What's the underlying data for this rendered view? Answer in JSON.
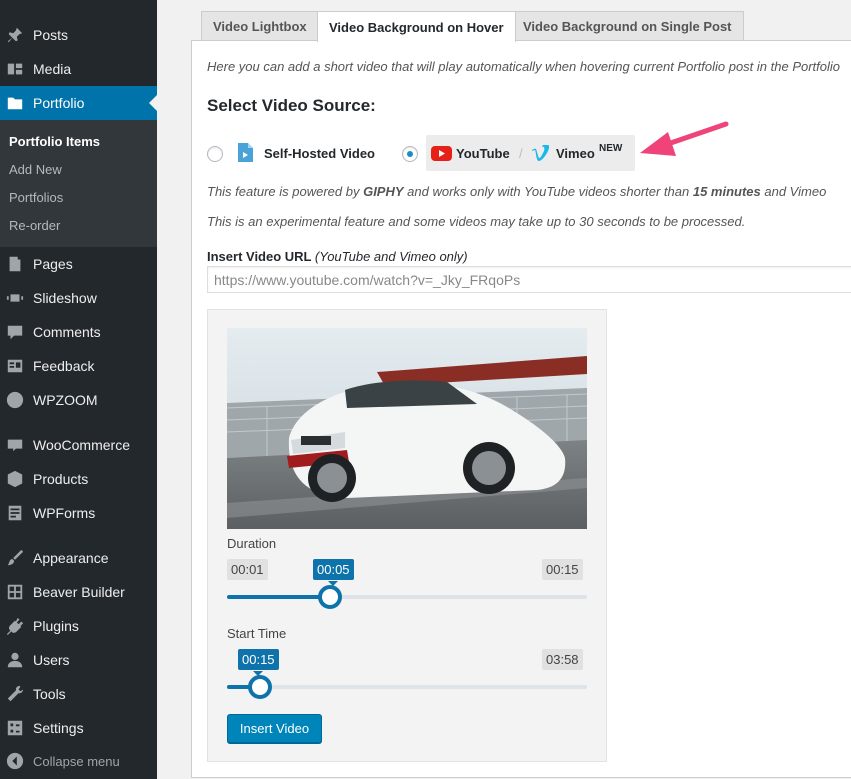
{
  "sidebar": {
    "items": [
      {
        "label": "Posts",
        "icon": "pin-icon"
      },
      {
        "label": "Media",
        "icon": "media-icon"
      },
      {
        "label": "Portfolio",
        "icon": "folder-icon"
      },
      {
        "label": "Pages",
        "icon": "pages-icon"
      },
      {
        "label": "Slideshow",
        "icon": "slideshow-icon"
      },
      {
        "label": "Comments",
        "icon": "comments-icon"
      },
      {
        "label": "Feedback",
        "icon": "feedback-icon"
      },
      {
        "label": "WPZOOM",
        "icon": "wpzoom-icon"
      },
      {
        "label": "WooCommerce",
        "icon": "woocommerce-icon"
      },
      {
        "label": "Products",
        "icon": "products-icon"
      },
      {
        "label": "WPForms",
        "icon": "wpforms-icon"
      },
      {
        "label": "Appearance",
        "icon": "brush-icon"
      },
      {
        "label": "Beaver Builder",
        "icon": "grid-icon"
      },
      {
        "label": "Plugins",
        "icon": "plug-icon"
      },
      {
        "label": "Users",
        "icon": "user-icon"
      },
      {
        "label": "Tools",
        "icon": "wrench-icon"
      },
      {
        "label": "Settings",
        "icon": "settings-icon"
      }
    ],
    "submenu": [
      "Portfolio Items",
      "Add New",
      "Portfolios",
      "Re-order"
    ],
    "collapse_label": "Collapse menu"
  },
  "tabs": [
    "Video Lightbox",
    "Video Background on Hover",
    "Video Background on Single Post"
  ],
  "intro": "Here you can add a short video that will play automatically when hovering current Portfolio post in the Portfolio",
  "section_title": "Select Video Source:",
  "options": {
    "self_hosted": "Self-Hosted Video",
    "youtube": "YouTube",
    "separator": "/",
    "vimeo": "Vimeo",
    "new_badge": "NEW"
  },
  "notes": {
    "powered_prefix": "This feature is powered by ",
    "giphy": "GIPHY",
    "powered_middle": " and works only with YouTube videos shorter than ",
    "limit": "15 minutes",
    "powered_suffix": " and Vimeo",
    "experimental": "This is an experimental feature and some videos may take up to 30 seconds to be processed."
  },
  "url_field": {
    "label": "Insert Video URL",
    "hint": "(YouTube and Vimeo only)",
    "value": "https://www.youtube.com/watch?v=_Jky_FRqoPs"
  },
  "duration": {
    "label": "Duration",
    "min": "00:01",
    "value": "00:05",
    "max": "00:15",
    "fraction": 0.2857
  },
  "start_time": {
    "label": "Start Time",
    "value": "00:15",
    "max": "03:58",
    "fraction": 0.0917
  },
  "insert_button": "Insert Video",
  "colors": {
    "accent": "#0073aa",
    "arrow": "#f0437a",
    "youtube": "#e62117",
    "vimeo": "#1ab7ea"
  }
}
